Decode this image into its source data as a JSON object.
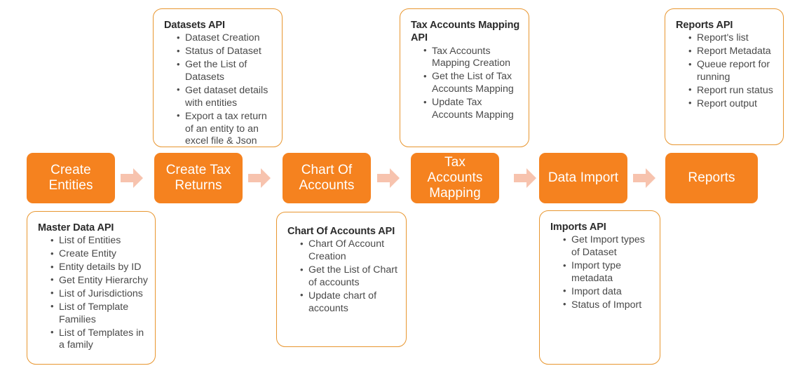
{
  "colors": {
    "process_fill": "#F5821F",
    "process_text": "#FFFFFF",
    "arrow_fill": "#F7C3AE",
    "callout_border": "#E8962F",
    "callout_title_text": "#2B2B2B",
    "callout_body_text": "#4A4A4A",
    "background": "#FFFFFF"
  },
  "flow": {
    "steps": [
      {
        "id": "create-entities",
        "label": "Create\nEntities"
      },
      {
        "id": "create-tax-returns",
        "label": "Create Tax\nReturns"
      },
      {
        "id": "chart-of-accounts",
        "label": "Chart Of\nAccounts"
      },
      {
        "id": "tax-accounts-mapping",
        "label": "Tax\nAccounts\nMapping"
      },
      {
        "id": "data-import",
        "label": "Data Import"
      },
      {
        "id": "reports",
        "label": "Reports"
      }
    ],
    "arrows": [
      {
        "id": "arrow-1",
        "from": "create-entities",
        "to": "create-tax-returns"
      },
      {
        "id": "arrow-2",
        "from": "create-tax-returns",
        "to": "chart-of-accounts"
      },
      {
        "id": "arrow-3",
        "from": "chart-of-accounts",
        "to": "tax-accounts-mapping"
      },
      {
        "id": "arrow-4",
        "from": "tax-accounts-mapping",
        "to": "data-import"
      },
      {
        "id": "arrow-5",
        "from": "data-import",
        "to": "reports"
      }
    ]
  },
  "callouts": {
    "datasets_api": {
      "title": "Datasets API",
      "items": [
        "Dataset Creation",
        "Status of Dataset",
        "Get the List of Datasets",
        "Get dataset details with entities",
        "Export a tax return of an entity to an excel file & Json"
      ]
    },
    "tax_accounts_mapping_api": {
      "title": "Tax Accounts Mapping API",
      "items": [
        "Tax Accounts Mapping Creation",
        "Get the List of Tax Accounts Mapping",
        "Update Tax Accounts Mapping"
      ]
    },
    "reports_api": {
      "title": "Reports API",
      "items": [
        "Report's list",
        "Report Metadata",
        "Queue report for running",
        "Report run status",
        "Report output"
      ]
    },
    "master_data_api": {
      "title": "Master Data API",
      "items": [
        "List of Entities",
        "Create Entity",
        "Entity details by ID",
        "Get Entity Hierarchy",
        "List of Jurisdictions",
        "List of Template Families",
        "List of Templates in a family"
      ]
    },
    "chart_of_accounts_api": {
      "title": "Chart Of Accounts API",
      "items": [
        "Chart Of Account Creation",
        "Get the List of Chart of accounts",
        "Update chart of accounts"
      ]
    },
    "imports_api": {
      "title": "Imports API",
      "items": [
        "Get Import types of Dataset",
        "Import type metadata",
        "Import data",
        "Status of Import"
      ]
    }
  }
}
